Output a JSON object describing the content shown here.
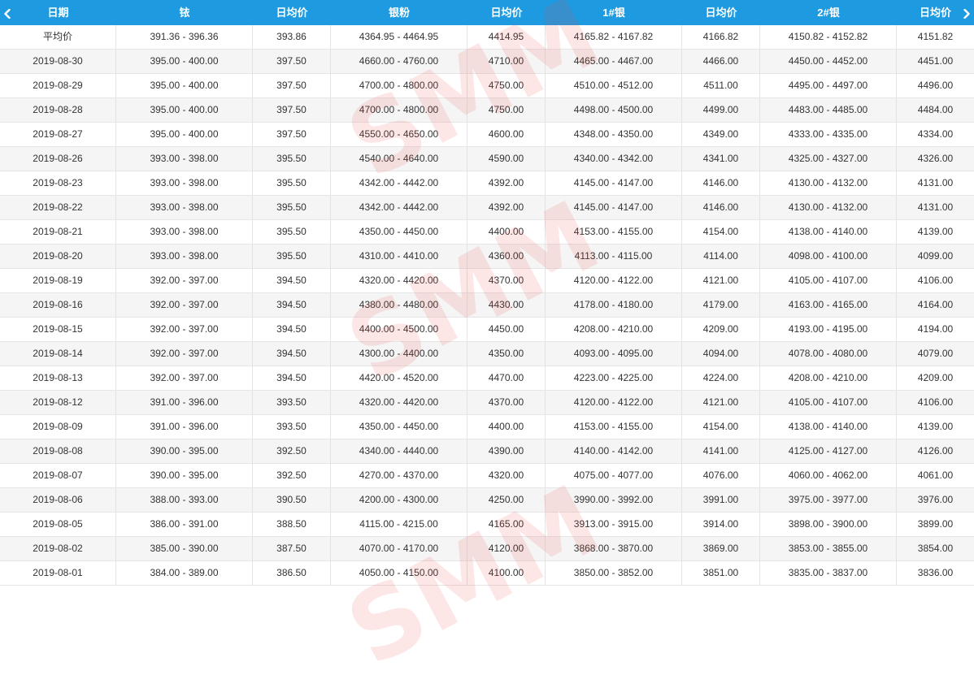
{
  "header": {
    "columns": [
      "日期",
      "铱",
      "日均价",
      "银粉",
      "日均价",
      "1#银",
      "日均价",
      "2#银",
      "日均价"
    ],
    "prev_icon": "chevron-left-icon",
    "next_icon": "chevron-right-icon"
  },
  "rows": [
    [
      "平均价",
      "391.36 - 396.36",
      "393.86",
      "4364.95 - 4464.95",
      "4414.95",
      "4165.82 - 4167.82",
      "4166.82",
      "4150.82 - 4152.82",
      "4151.82"
    ],
    [
      "2019-08-30",
      "395.00 - 400.00",
      "397.50",
      "4660.00 - 4760.00",
      "4710.00",
      "4465.00 - 4467.00",
      "4466.00",
      "4450.00 - 4452.00",
      "4451.00"
    ],
    [
      "2019-08-29",
      "395.00 - 400.00",
      "397.50",
      "4700.00 - 4800.00",
      "4750.00",
      "4510.00 - 4512.00",
      "4511.00",
      "4495.00 - 4497.00",
      "4496.00"
    ],
    [
      "2019-08-28",
      "395.00 - 400.00",
      "397.50",
      "4700.00 - 4800.00",
      "4750.00",
      "4498.00 - 4500.00",
      "4499.00",
      "4483.00 - 4485.00",
      "4484.00"
    ],
    [
      "2019-08-27",
      "395.00 - 400.00",
      "397.50",
      "4550.00 - 4650.00",
      "4600.00",
      "4348.00 - 4350.00",
      "4349.00",
      "4333.00 - 4335.00",
      "4334.00"
    ],
    [
      "2019-08-26",
      "393.00 - 398.00",
      "395.50",
      "4540.00 - 4640.00",
      "4590.00",
      "4340.00 - 4342.00",
      "4341.00",
      "4325.00 - 4327.00",
      "4326.00"
    ],
    [
      "2019-08-23",
      "393.00 - 398.00",
      "395.50",
      "4342.00 - 4442.00",
      "4392.00",
      "4145.00 - 4147.00",
      "4146.00",
      "4130.00 - 4132.00",
      "4131.00"
    ],
    [
      "2019-08-22",
      "393.00 - 398.00",
      "395.50",
      "4342.00 - 4442.00",
      "4392.00",
      "4145.00 - 4147.00",
      "4146.00",
      "4130.00 - 4132.00",
      "4131.00"
    ],
    [
      "2019-08-21",
      "393.00 - 398.00",
      "395.50",
      "4350.00 - 4450.00",
      "4400.00",
      "4153.00 - 4155.00",
      "4154.00",
      "4138.00 - 4140.00",
      "4139.00"
    ],
    [
      "2019-08-20",
      "393.00 - 398.00",
      "395.50",
      "4310.00 - 4410.00",
      "4360.00",
      "4113.00 - 4115.00",
      "4114.00",
      "4098.00 - 4100.00",
      "4099.00"
    ],
    [
      "2019-08-19",
      "392.00 - 397.00",
      "394.50",
      "4320.00 - 4420.00",
      "4370.00",
      "4120.00 - 4122.00",
      "4121.00",
      "4105.00 - 4107.00",
      "4106.00"
    ],
    [
      "2019-08-16",
      "392.00 - 397.00",
      "394.50",
      "4380.00 - 4480.00",
      "4430.00",
      "4178.00 - 4180.00",
      "4179.00",
      "4163.00 - 4165.00",
      "4164.00"
    ],
    [
      "2019-08-15",
      "392.00 - 397.00",
      "394.50",
      "4400.00 - 4500.00",
      "4450.00",
      "4208.00 - 4210.00",
      "4209.00",
      "4193.00 - 4195.00",
      "4194.00"
    ],
    [
      "2019-08-14",
      "392.00 - 397.00",
      "394.50",
      "4300.00 - 4400.00",
      "4350.00",
      "4093.00 - 4095.00",
      "4094.00",
      "4078.00 - 4080.00",
      "4079.00"
    ],
    [
      "2019-08-13",
      "392.00 - 397.00",
      "394.50",
      "4420.00 - 4520.00",
      "4470.00",
      "4223.00 - 4225.00",
      "4224.00",
      "4208.00 - 4210.00",
      "4209.00"
    ],
    [
      "2019-08-12",
      "391.00 - 396.00",
      "393.50",
      "4320.00 - 4420.00",
      "4370.00",
      "4120.00 - 4122.00",
      "4121.00",
      "4105.00 - 4107.00",
      "4106.00"
    ],
    [
      "2019-08-09",
      "391.00 - 396.00",
      "393.50",
      "4350.00 - 4450.00",
      "4400.00",
      "4153.00 - 4155.00",
      "4154.00",
      "4138.00 - 4140.00",
      "4139.00"
    ],
    [
      "2019-08-08",
      "390.00 - 395.00",
      "392.50",
      "4340.00 - 4440.00",
      "4390.00",
      "4140.00 - 4142.00",
      "4141.00",
      "4125.00 - 4127.00",
      "4126.00"
    ],
    [
      "2019-08-07",
      "390.00 - 395.00",
      "392.50",
      "4270.00 - 4370.00",
      "4320.00",
      "4075.00 - 4077.00",
      "4076.00",
      "4060.00 - 4062.00",
      "4061.00"
    ],
    [
      "2019-08-06",
      "388.00 - 393.00",
      "390.50",
      "4200.00 - 4300.00",
      "4250.00",
      "3990.00 - 3992.00",
      "3991.00",
      "3975.00 - 3977.00",
      "3976.00"
    ],
    [
      "2019-08-05",
      "386.00 - 391.00",
      "388.50",
      "4115.00 - 4215.00",
      "4165.00",
      "3913.00 - 3915.00",
      "3914.00",
      "3898.00 - 3900.00",
      "3899.00"
    ],
    [
      "2019-08-02",
      "385.00 - 390.00",
      "387.50",
      "4070.00 - 4170.00",
      "4120.00",
      "3868.00 - 3870.00",
      "3869.00",
      "3853.00 - 3855.00",
      "3854.00"
    ],
    [
      "2019-08-01",
      "384.00 - 389.00",
      "386.50",
      "4050.00 - 4150.00",
      "4100.00",
      "3850.00 - 3852.00",
      "3851.00",
      "3835.00 - 3837.00",
      "3836.00"
    ]
  ],
  "watermark": {
    "text": "SMM",
    "color": "#eb3c3c"
  }
}
